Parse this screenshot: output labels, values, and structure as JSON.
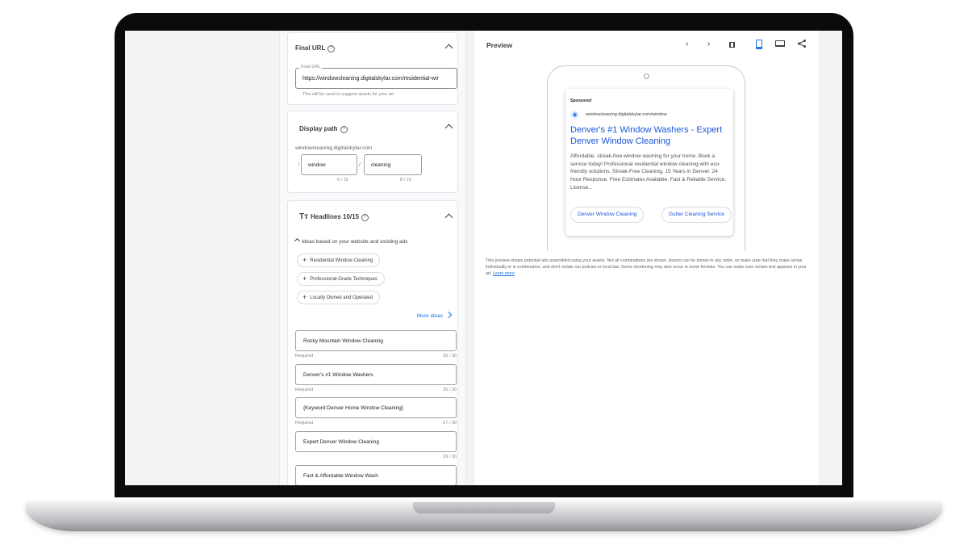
{
  "final_url": {
    "title": "Final URL",
    "field_label": "Final URL",
    "value": "https://windowcleaning.digitalskylar.com/residential-wir",
    "helper": "This will be used to suggest assets for your ad"
  },
  "display_path": {
    "title": "Display path",
    "domain": "windowcleaning.digitalskylar.com",
    "separator": "/",
    "path1": "window",
    "path1_count": "6 / 15",
    "path2": "cleaning",
    "path2_count": "8 / 15"
  },
  "headlines": {
    "icon_text": "Tт",
    "title": "Headlines 10/15",
    "ideas_label": "Ideas based on your website and existing ads",
    "ideas": [
      "Residential Window Cleaning",
      "Professional-Grade Techniques",
      "Locally Owned and Operated"
    ],
    "more_ideas": "More ideas",
    "items": [
      {
        "text": "Rocky Mountain Window Cleaning",
        "required": "Required",
        "count": "30 / 30"
      },
      {
        "text": "Denver's #1 Window Washers",
        "required": "Required",
        "count": "26 / 30"
      },
      {
        "text": "{Keyword:Denver Home Window Cleaning}",
        "required": "Required",
        "count": "27 / 30"
      },
      {
        "text": "Expert Denver Window Cleaning",
        "required": "",
        "count": "29 / 30"
      },
      {
        "text": "Fast & Affordable Window Wash",
        "required": "",
        "count": ""
      }
    ]
  },
  "preview": {
    "title": "Preview",
    "ad": {
      "sponsored": "Sponsored",
      "url": "windowcleaning.digitalskylar.com/window",
      "headline": "Denver's #1 Window Washers - Expert Denver Window Cleaning",
      "description": "Affordable, streak-free window washing for your home. Book a service today! Professional residential window cleaning with eco-friendly solutions. Streak-Free Cleaning. 15 Years in Denver. 24 Hour Response. Free Estimates Available. Fast & Reliable Service. License...",
      "sitelinks": [
        "Denver Window Cleaning",
        "Gutter Cleaning Service"
      ]
    },
    "disclaimer": "This preview shows potential ads assembled using your assets. Not all combinations are shown. Assets can be shown in any order, so make sure that they make sense individually or in combination, and don't violate our policies or local law. Some shortening may also occur in some formats. You can make sure certain text appears in your ad.",
    "learn_more": "Learn more"
  },
  "colors": {
    "accent_blue": "#1a73e8",
    "ad_link_blue": "#1a56db"
  }
}
